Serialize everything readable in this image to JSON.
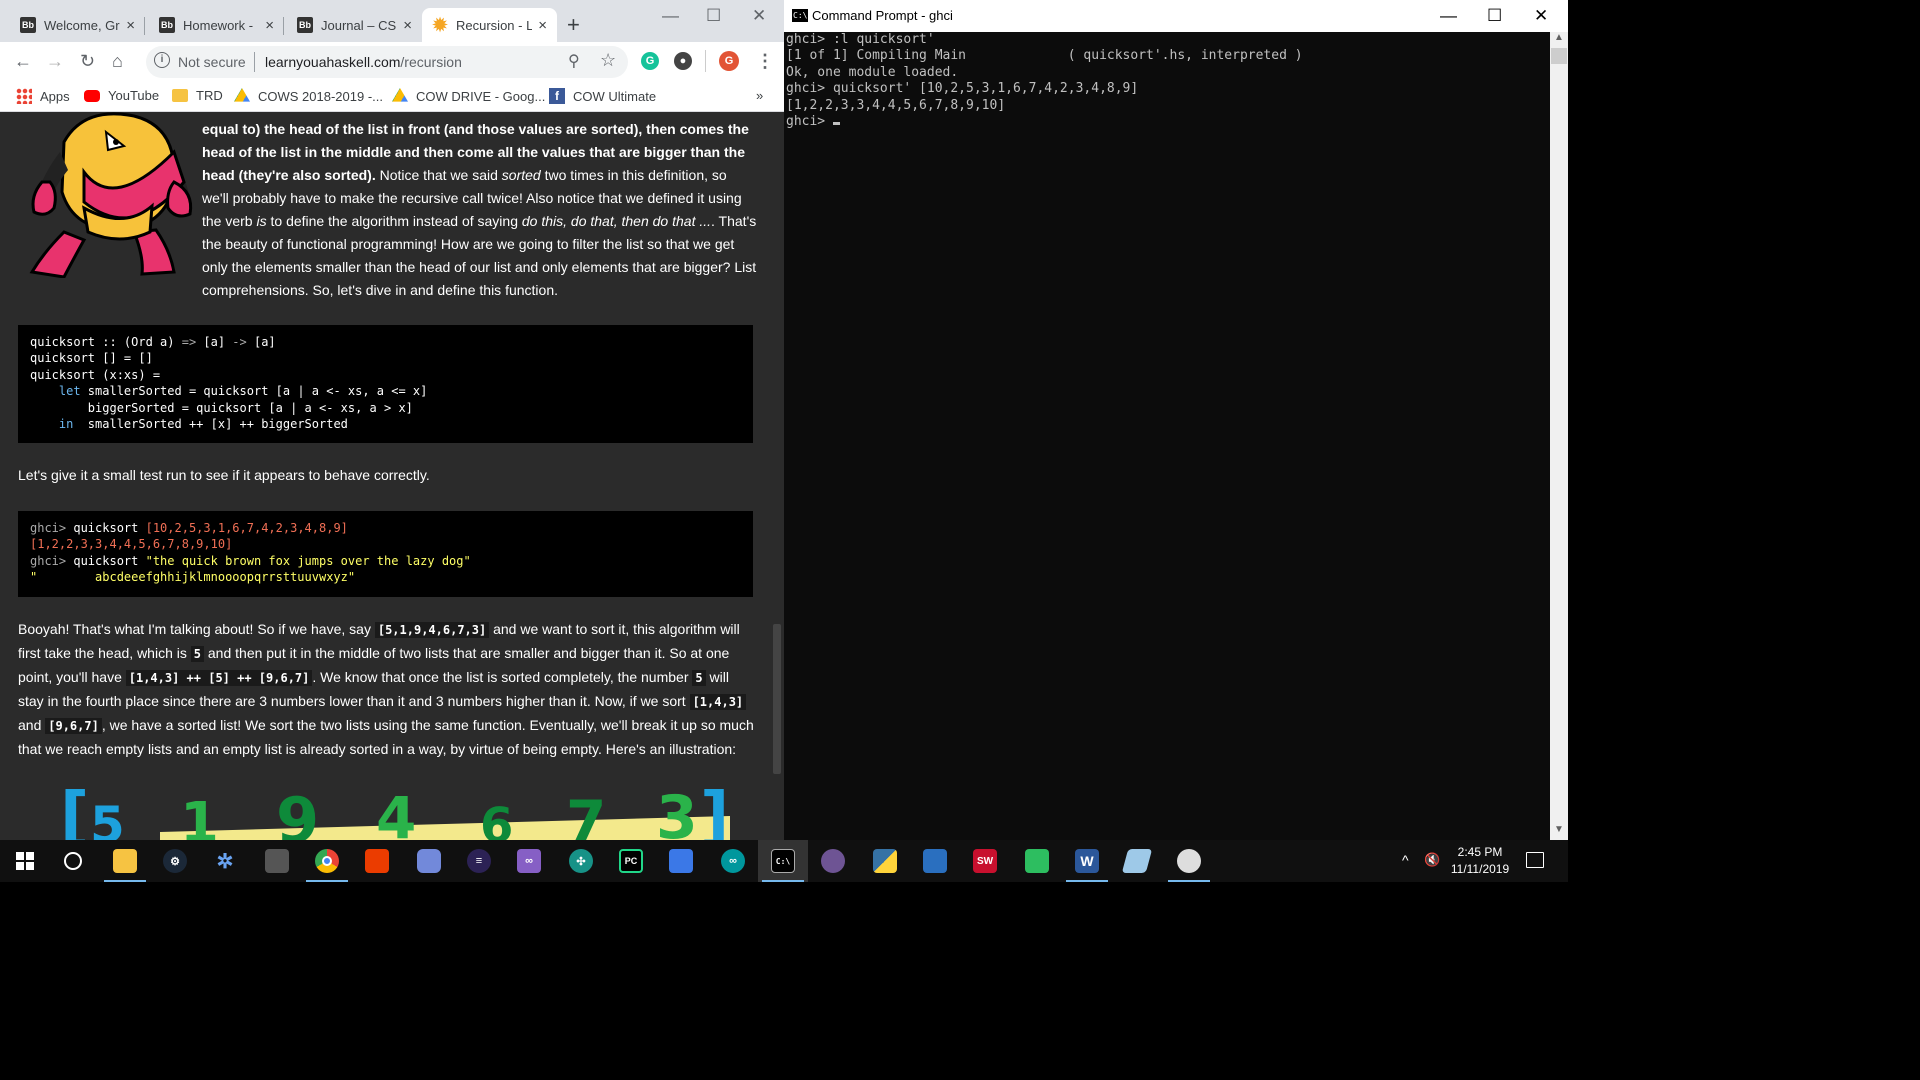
{
  "browser": {
    "tabs": [
      {
        "label": "Welcome, Gr",
        "favicon": "Bb"
      },
      {
        "label": "Homework -",
        "favicon": "Bb"
      },
      {
        "label": "Journal – CS",
        "favicon": "Bb"
      },
      {
        "label": "Recursion - L",
        "favicon": "sun-icon"
      }
    ],
    "address": {
      "security": "Not secure",
      "host": "learnyouahaskell.com",
      "path": "/recursion"
    },
    "profile_initial": "G",
    "bookmarks": [
      "Apps",
      "YouTube",
      "TRD",
      "COWS 2018-2019 -...",
      "COW DRIVE - Goog...",
      "COW Ultimate"
    ],
    "bookmarks_overflow": "»"
  },
  "article": {
    "para1_bold": "equal to) the head of the list in front (and those values are sorted), then comes the head of the list in the middle and then come all the values that are bigger than the head (they're also sorted).",
    "para1_a": " Notice that we said ",
    "para1_em1": "sorted",
    "para1_b": " two times in this definition, so we'll probably have to make the recursive call twice! Also notice that we defined it using the verb ",
    "para1_em2": "is",
    "para1_c": " to define the algorithm instead of saying ",
    "para1_em3": "do this, do that, then do that ...",
    "para1_d": ". That's the beauty of functional programming! How are we going to filter the list so that we get only the elements smaller than the head of our list and only elements that are bigger? List comprehensions. So, let's dive in and define this function.",
    "code1": {
      "l1a": "quicksort :: (Ord a) ",
      "l1b": "=>",
      "l1c": " [a] ",
      "l1d": "->",
      "l1e": " [a]",
      "l2": "quicksort [] = []",
      "l3": "quicksort (x:xs) =",
      "l4kw": "    let",
      "l4": " smallerSorted = quicksort [a | a <- xs, a <= x]",
      "l5": "        biggerSorted = quicksort [a | a <- xs, a > x]",
      "l6kw": "    in",
      "l6": "  smallerSorted ++ [x] ++ biggerSorted"
    },
    "para2": "Let's give it a small test run to see if it appears to behave correctly.",
    "code2": {
      "p1": "ghci> ",
      "c1": "quicksort ",
      "v1": "[10,2,5,3,1,6,7,4,2,3,4,8,9]",
      "r1": "[1,2,2,3,3,4,4,5,6,7,8,9,10]",
      "p2": "ghci> ",
      "c2": "quicksort ",
      "v2": "\"the quick brown fox jumps over the lazy dog\"",
      "r2": "\"        abcdeeefghhijklmnoooopqrrsttuuvwxyz\""
    },
    "para3": {
      "a": "Booyah! That's what I'm talking about! So if we have, say ",
      "c1": "[5,1,9,4,6,7,3]",
      "b": " and we want to sort it, this algorithm will first take the head, which is ",
      "c2": "5",
      "c": " and then put it in the middle of two lists that are smaller and bigger than it. So at one point, you'll have ",
      "c3": "[1,4,3] ++ [5] ++ [9,6,7]",
      "d": ". We know that once the list is sorted completely, the number ",
      "c4": "5",
      "e": " will stay in the fourth place since there are 3 numbers lower than it and 3 numbers higher than it. Now, if we sort ",
      "c5": "[1,4,3]",
      "f": " and ",
      "c6": "[9,6,7]",
      "g": ", we have a sorted list! We sort the two lists using the same function. Eventually, we'll break it up so much that we reach empty lists and an empty list is already sorted in a way, by virtue of being empty. Here's an illustration:"
    },
    "illustration_glyphs": [
      "[",
      "5",
      "1",
      "9",
      "4",
      "6",
      "7",
      "3",
      "]"
    ]
  },
  "cmd": {
    "title": "Command Prompt - ghci",
    "lines": [
      "ghci> :l quicksort'",
      "[1 of 1] Compiling Main             ( quicksort'.hs, interpreted )",
      "Ok, one module loaded.",
      "ghci> quicksort' [10,2,5,3,1,6,7,4,2,3,4,8,9]",
      "[1,2,2,3,3,4,4,5,6,7,8,9,10]"
    ],
    "prompt": "ghci> "
  },
  "taskbar": {
    "apps": [
      "start-icon",
      "cortana-icon",
      "file-explorer-icon",
      "steam-icon",
      "vs-installer-icon",
      "game-icon",
      "chrome-icon",
      "office-icon",
      "discord-icon",
      "eclipse-icon",
      "visual-studio-icon",
      "gitkraken-icon",
      "pycharm-icon",
      "control-panel-icon",
      "arduino-icon",
      "cmd-icon",
      "github-desktop-icon",
      "python-icon",
      "network-icon",
      "solidworks-icon",
      "evernote-icon",
      "word-icon",
      "notepad-icon",
      "paint-icon"
    ],
    "time": "2:45 PM",
    "date": "11/11/2019"
  }
}
